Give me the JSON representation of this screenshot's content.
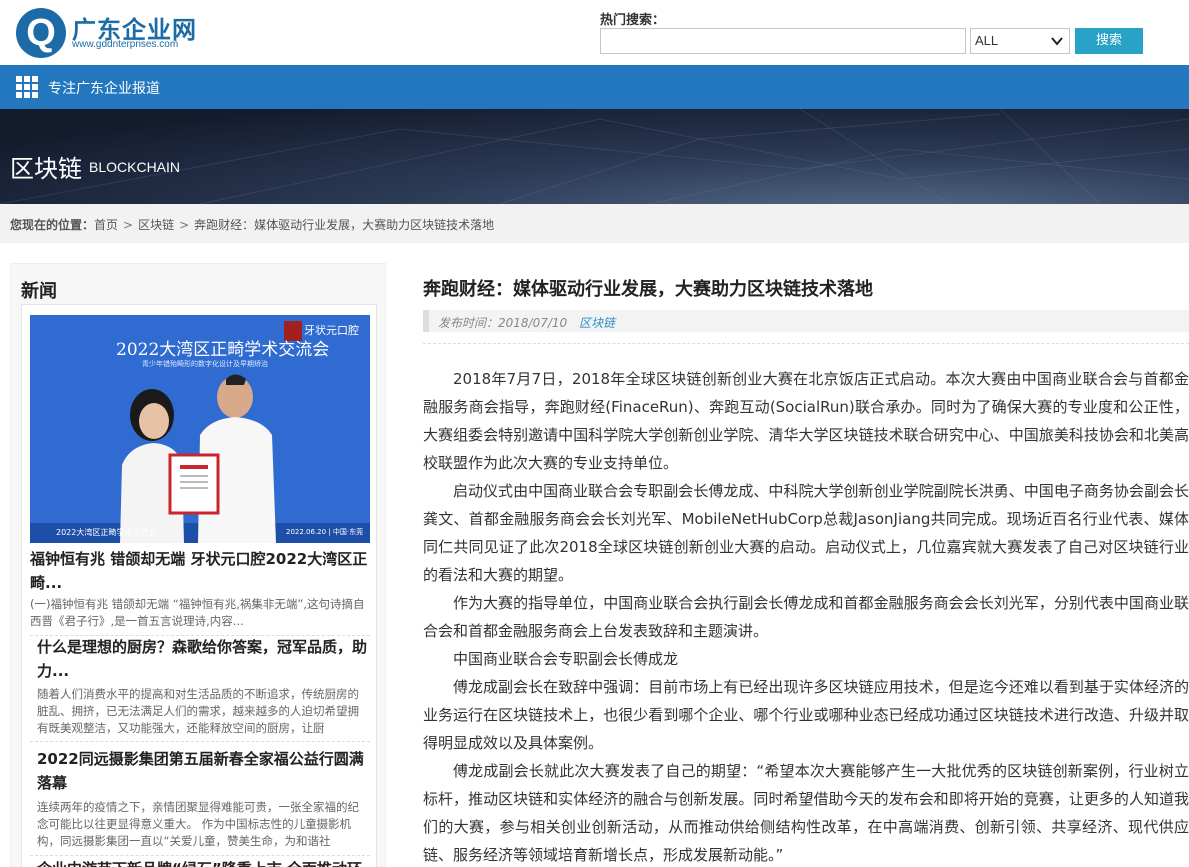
{
  "header": {
    "logo_letter": "Q",
    "logo_text": "广东企业网",
    "logo_url_text": "www.gddnterprises.com",
    "search_label": "热门搜索：",
    "search_value": "",
    "search_select": "ALL",
    "search_button": "搜索"
  },
  "nav": {
    "text": "专注广东企业报道"
  },
  "banner": {
    "title_cn": "区块链",
    "title_en": "BLOCKCHAIN"
  },
  "breadcrumb": {
    "prefix": "您现在的位置：",
    "items": [
      "首页",
      "区块链",
      "奔跑财经：媒体驱动行业发展，大赛助力区块链技术落地"
    ],
    "separator": ">"
  },
  "sidebar": {
    "title": "新闻",
    "image_caption_top": "2022大湾区正畸学术交流会",
    "image_caption_sub": "青少年错殆畸形的数字化设计及早期矫治",
    "image_brand": "牙状元口腔",
    "image_footer_left": "2022大湾区正畸学术交流会",
    "image_footer_right": "2022.06.20 | 中国·东莞",
    "items": [
      {
        "title": "福钟恒有兆 错颌却无端 牙状元口腔2022大湾区正畸...",
        "desc": "(一)福钟恒有兆 错颌却无端 “福钟恒有兆,祸集非无端”,这句诗摘自西晋《君子行》,是一首五言说理诗,内容..."
      },
      {
        "title": "什么是理想的厨房？森歌给你答案，冠军品质，助力...",
        "desc": "随着人们消费水平的提高和对生活品质的不断追求，传统厨房的脏乱、拥挤，已无法满足人们的需求，越来越多的人迫切希望拥有既美观整洁，又功能强大，还能释放空间的厨房，让厨"
      },
      {
        "title": "2022同远摄影集团第五届新春全家福公益行圆满落幕",
        "desc": "连续两年的疫情之下，亲情团聚显得难能可贵，一张全家福的纪念可能比以往更显得意义重大。 作为中国标志性的儿童摄影机构，同远摄影集团一直以“关爱儿童，赞美生命，为和谐社"
      },
      {
        "title": "企业中游苗下新品牌“绿石”隆重上市 全面推动环",
        "desc": ""
      }
    ]
  },
  "article": {
    "title": "奔跑财经：媒体驱动行业发展，大赛助力区块链技术落地",
    "date": "发布时间：2018/07/10",
    "category": "区块链",
    "paragraphs": [
      "2018年7月7日，2018年全球区块链创新创业大赛在北京饭店正式启动。本次大赛由中国商业联合会与首都金融服务商会指导，奔跑财经(FinaceRun)、奔跑互动(SocialRun)联合承办。同时为了确保大赛的专业度和公正性，大赛组委会特别邀请中国科学院大学创新创业学院、清华大学区块链技术联合研究中心、中国旅美科技协会和北美高校联盟作为此次大赛的专业支持单位。",
      "启动仪式由中国商业联合会专职副会长傅龙成、中科院大学创新创业学院副院长洪勇、中国电子商务协会副会长龚文、首都金融服务商会会长刘光军、MobileNetHubCorp总裁JasonJiang共同完成。现场近百名行业代表、媒体同仁共同见证了此次2018全球区块链创新创业大赛的启动。启动仪式上，几位嘉宾就大赛发表了自己对区块链行业的看法和大赛的期望。",
      "作为大赛的指导单位，中国商业联合会执行副会长傅龙成和首都金融服务商会会长刘光军，分别代表中国商业联合会和首都金融服务商会上台发表致辞和主题演讲。",
      "中国商业联合会专职副会长傅成龙",
      "傅龙成副会长在致辞中强调：目前市场上有已经出现许多区块链应用技术，但是迄今还难以看到基于实体经济的业务运行在区块链技术上，也很少看到哪个企业、哪个行业或哪种业态已经成功通过区块链技术进行改造、升级并取得明显成效以及具体案例。",
      "傅龙成副会长就此次大赛发表了自己的期望：“希望本次大赛能够产生一大批优秀的区块链创新案例，行业树立标杆，推动区块链和实体经济的融合与创新发展。同时希望借助今天的发布会和即将开始的竞赛，让更多的人知道我们的大赛，参与相关创业创新活动，从而推动供给侧结构性改革，在中高端消费、创新引领、共享经济、现代供应链、服务经济等领域培育新增长点，形成发展新动能。”"
    ]
  }
}
